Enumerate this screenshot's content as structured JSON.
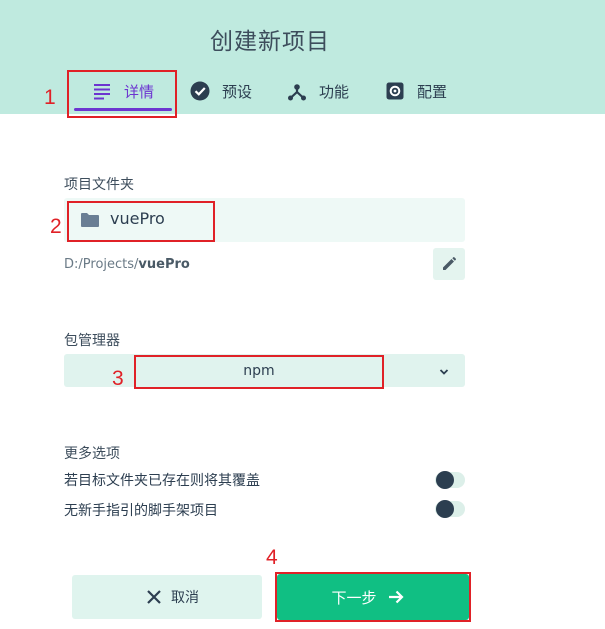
{
  "header": {
    "title": "创建新项目",
    "tabs": [
      {
        "label": "详情",
        "icon": "subject-icon"
      },
      {
        "label": "预设",
        "icon": "check-circle-icon"
      },
      {
        "label": "功能",
        "icon": "call-split-icon"
      },
      {
        "label": "配置",
        "icon": "settings-icon"
      }
    ]
  },
  "annotations": [
    "1",
    "2",
    "3",
    "4"
  ],
  "folder": {
    "label": "项目文件夹",
    "value": "vuePro",
    "path_prefix": "D:/Projects/",
    "path_name": "vuePro"
  },
  "package_manager": {
    "label": "包管理器",
    "selected": "npm"
  },
  "more_options": {
    "label": "更多选项",
    "options": [
      {
        "label": "若目标文件夹已存在则将其覆盖",
        "enabled": false
      },
      {
        "label": "无新手指引的脚手架项目",
        "enabled": false
      }
    ]
  },
  "actions": {
    "cancel_label": "取消",
    "next_label": "下一步"
  },
  "colors": {
    "header_bg": "#bfeadf",
    "accent_purple": "#6c35d0",
    "primary_green": "#10bf83",
    "annotation_red": "#e02127"
  }
}
